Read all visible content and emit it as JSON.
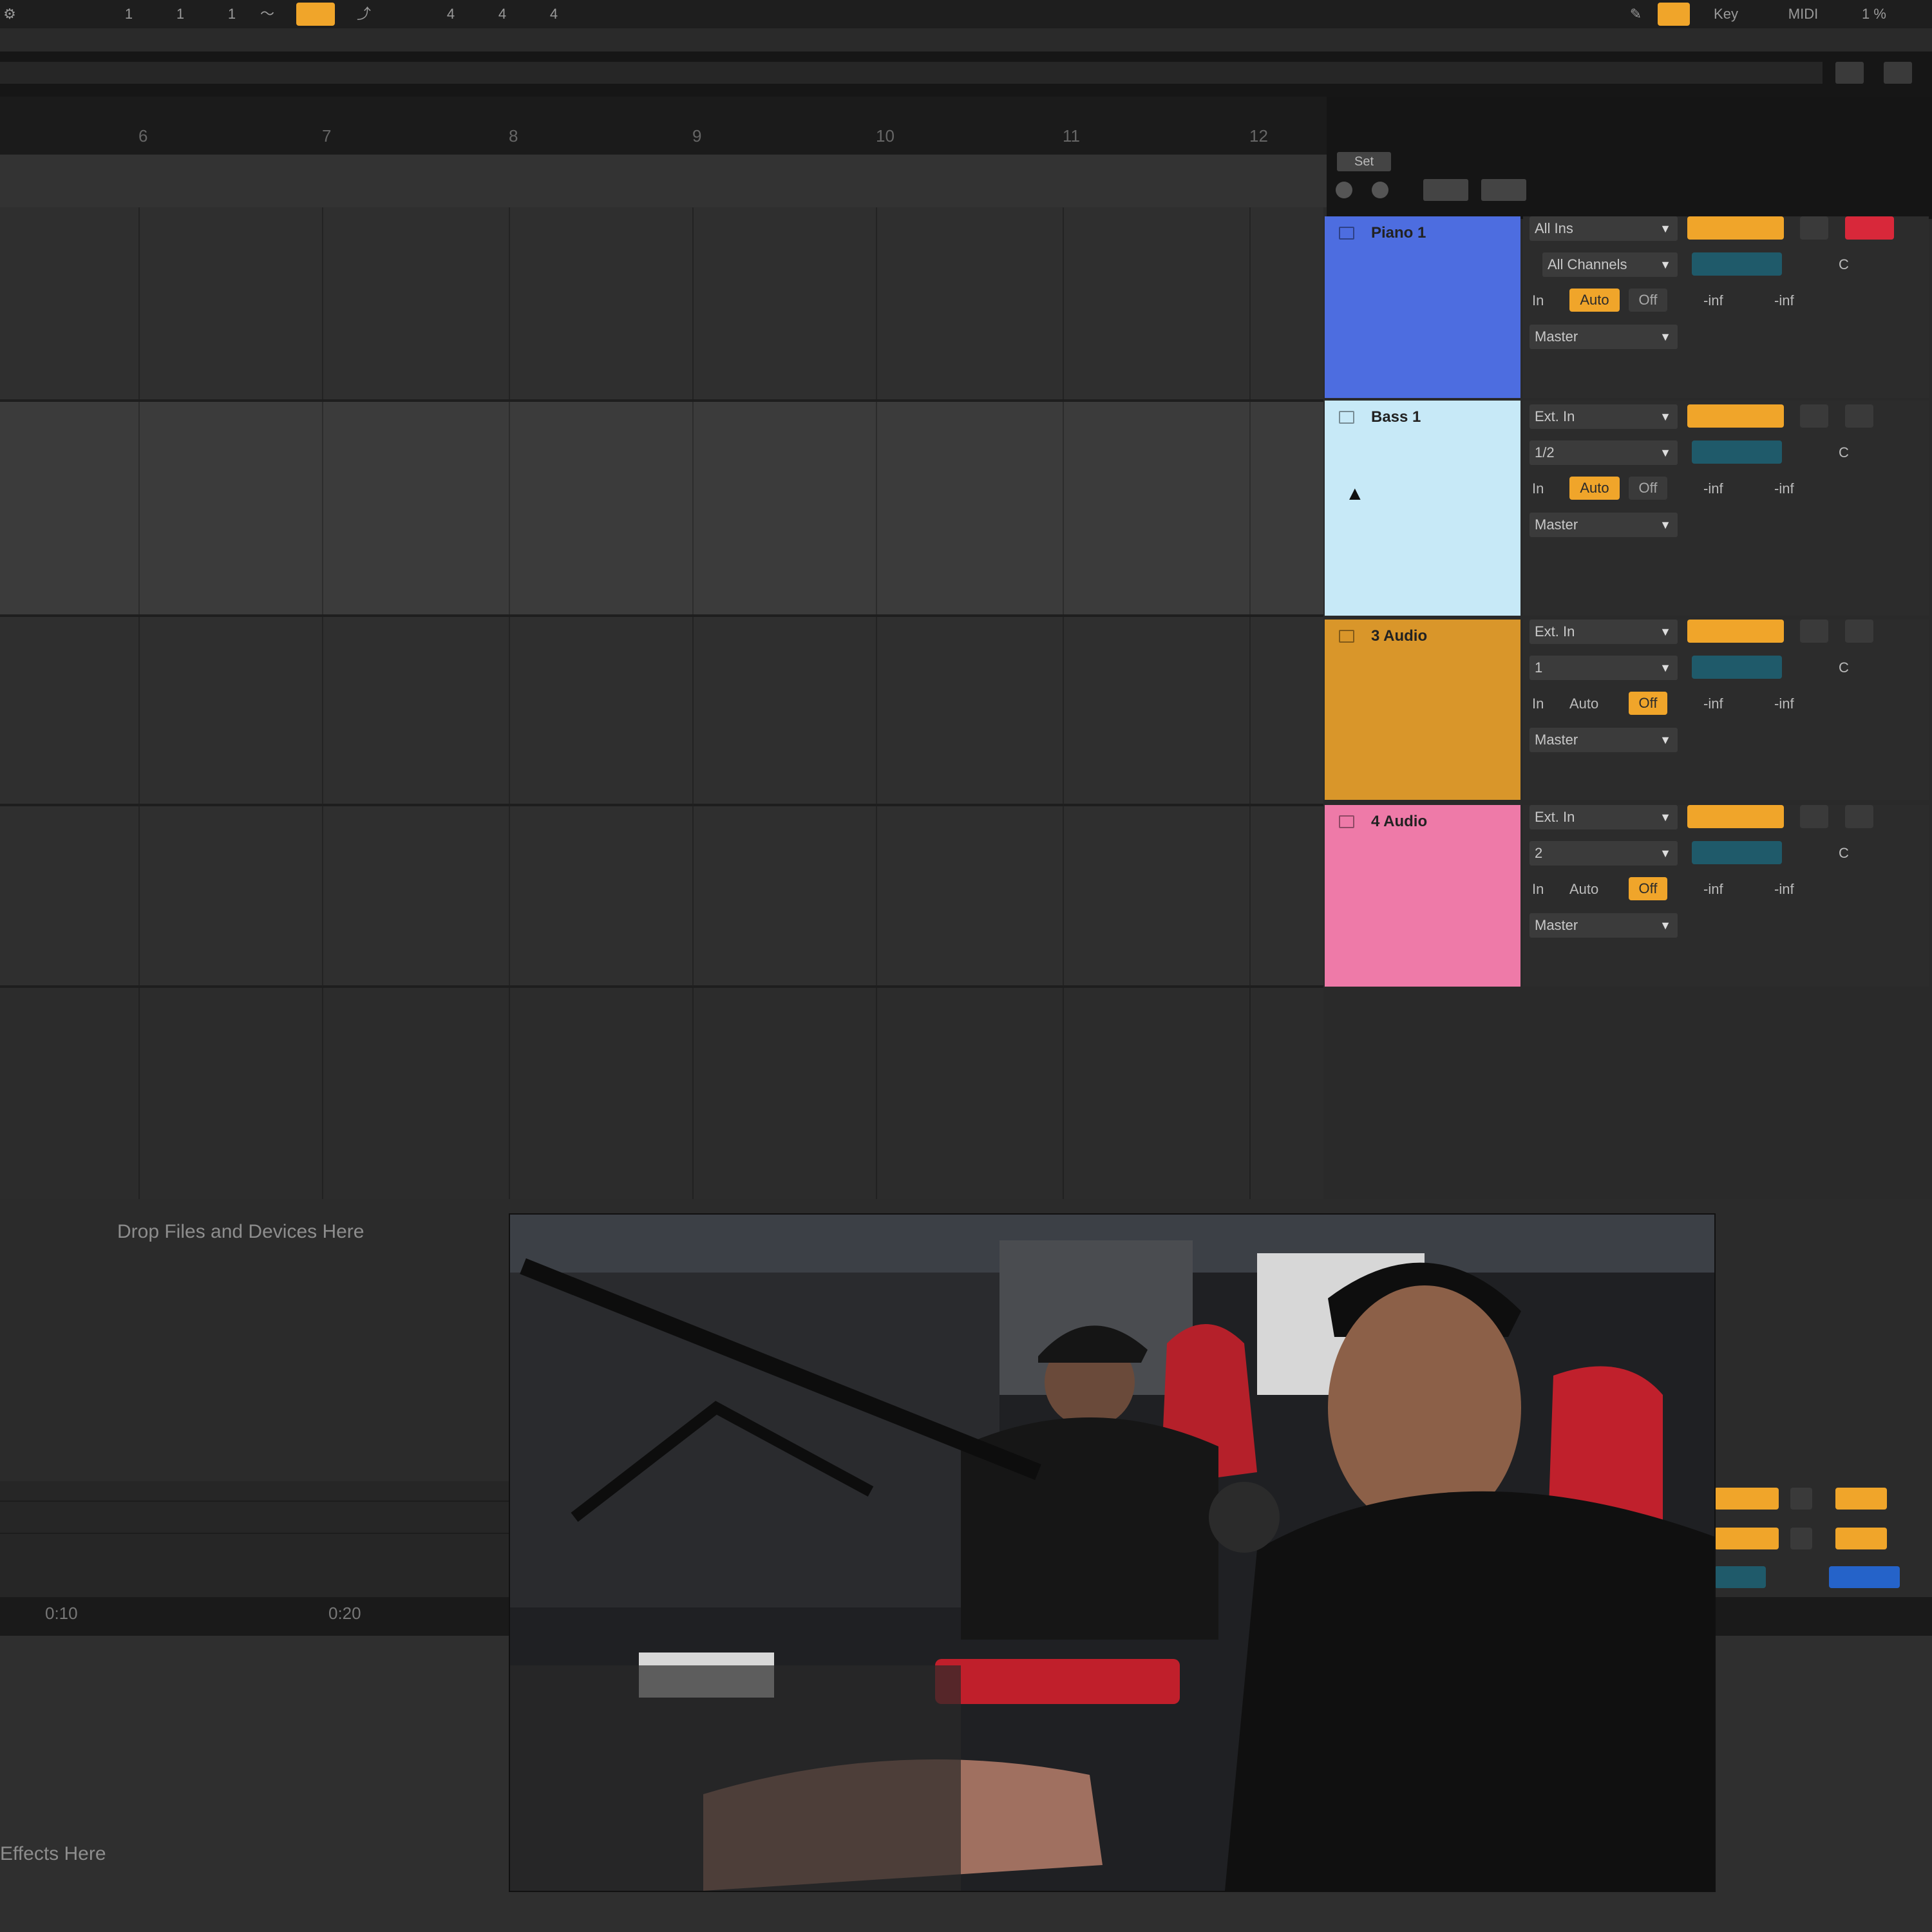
{
  "toolbar": {
    "loop_values": [
      "1",
      "1",
      "1"
    ],
    "numbers_right": [
      "4",
      "4",
      "4"
    ],
    "key_label": "Key",
    "midi_label": "MIDI",
    "cpu_label": "1 %"
  },
  "ruler": {
    "ticks": [
      "6",
      "7",
      "8",
      "9",
      "10",
      "11",
      "12"
    ],
    "set_label": "Set"
  },
  "tracks": [
    {
      "name": "Piano 1",
      "color": "#4d6de0",
      "input_type": "All Ins",
      "input_channel": "All Channels",
      "monitor_in": "In",
      "monitor_auto": "Auto",
      "monitor_off": "Off",
      "output": "Master",
      "vol": "-inf",
      "pan": "C"
    },
    {
      "name": "Bass 1",
      "color": "#c7e9f7",
      "input_type": "Ext. In",
      "input_channel": "1/2",
      "monitor_in": "In",
      "monitor_auto": "Auto",
      "monitor_off": "Off",
      "output": "Master",
      "vol": "-inf",
      "pan": "C"
    },
    {
      "name": "3 Audio",
      "color": "#d9962a",
      "input_type": "Ext. In",
      "input_channel": "1",
      "monitor_in": "In",
      "monitor_auto": "Auto",
      "monitor_off": "Off",
      "output": "Master",
      "vol": "-inf",
      "pan": "C"
    },
    {
      "name": "4 Audio",
      "color": "#ee7aa8",
      "input_type": "Ext. In",
      "input_channel": "2",
      "monitor_in": "In",
      "monitor_auto": "Auto",
      "monitor_off": "Off",
      "output": "Master",
      "vol": "-inf",
      "pan": "C"
    }
  ],
  "drop_zone": {
    "files_text": "Drop Files and Devices Here",
    "effects_text": "Effects Here"
  },
  "lower_time": [
    "0:10",
    "0:20"
  ],
  "video": {
    "description": ""
  }
}
